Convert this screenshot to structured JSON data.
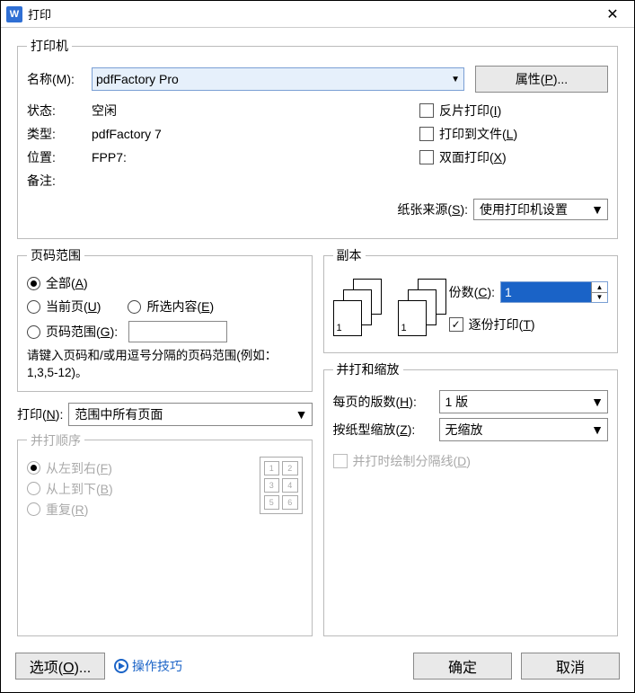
{
  "title": "打印",
  "printer": {
    "group": "打印机",
    "name_label": "名称(M):",
    "name_value": "pdfFactory Pro",
    "props_btn": "属性(P)...",
    "status_label": "状态:",
    "status_value": "空闲",
    "type_label": "类型:",
    "type_value": "pdfFactory 7",
    "where_label": "位置:",
    "where_value": "FPP7:",
    "comment_label": "备注:",
    "comment_value": "",
    "chk_mirror": "反片打印(I)",
    "chk_tofile": "打印到文件(L)",
    "chk_duplex": "双面打印(X)"
  },
  "paper": {
    "label": "纸张来源(S):",
    "value": "使用打印机设置"
  },
  "pages": {
    "group": "页码范围",
    "all": "全部(A)",
    "current": "当前页(U)",
    "selection": "所选内容(E)",
    "range": "页码范围(G):",
    "hint": "请键入页码和/或用逗号分隔的页码范围(例如：1,3,5-12)。"
  },
  "print_sel": {
    "label": "打印(N):",
    "value": "范围中所有页面"
  },
  "order": {
    "group": "并打顺序",
    "lr": "从左到右(F)",
    "tb": "从上到下(B)",
    "rep": "重复(R)"
  },
  "copies": {
    "group": "副本",
    "count_label": "份数(C):",
    "count_value": "1",
    "collate": "逐份打印(T)"
  },
  "zoom": {
    "group": "并打和缩放",
    "per_label": "每页的版数(H):",
    "per_value": "1 版",
    "scale_label": "按纸型缩放(Z):",
    "scale_value": "无缩放",
    "sep": "并打时绘制分隔线(D)"
  },
  "footer": {
    "options": "选项(O)...",
    "tips": "操作技巧",
    "ok": "确定",
    "cancel": "取消"
  }
}
